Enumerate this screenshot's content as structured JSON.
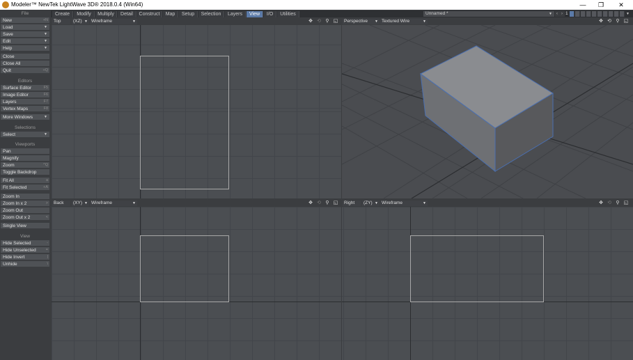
{
  "window": {
    "title": "Modeler™ NewTek LightWave 3D® 2018.0.4 (Win64)",
    "minimize": "—",
    "restore": "❐",
    "close": "✕"
  },
  "menu_tabs": [
    "Create",
    "Modify",
    "Multiply",
    "Detail",
    "Construct",
    "Map",
    "Setup",
    "Selection",
    "Layers",
    "View",
    "I/O",
    "Utilities"
  ],
  "active_tab": "View",
  "scene_name": "Unnamed *",
  "layer_number": "1",
  "sidebar": {
    "file_header": "File",
    "file_items": [
      {
        "label": "New",
        "shortcut": "+N"
      },
      {
        "label": "Load",
        "dropdown": true
      },
      {
        "label": "Save",
        "dropdown": true
      },
      {
        "label": "Edit",
        "dropdown": true
      },
      {
        "label": "Help",
        "dropdown": true
      }
    ],
    "misc_items": [
      {
        "label": "Close",
        "shortcut": ""
      },
      {
        "label": "Close All",
        "shortcut": ""
      },
      {
        "label": "Quit",
        "shortcut": "+Q"
      }
    ],
    "editors_header": "Editors",
    "editors_items": [
      {
        "label": "Surface Editor",
        "shortcut": "F5"
      },
      {
        "label": "Image Editor",
        "shortcut": "F6"
      },
      {
        "label": "Layers",
        "shortcut": "F7"
      },
      {
        "label": "Vertex Maps",
        "shortcut": "F8"
      }
    ],
    "more_windows": "More Windows",
    "selections_header": "Selections",
    "select": "Select",
    "viewports_header": "Viewports",
    "viewports_items": [
      {
        "label": "Pan",
        "shortcut": ""
      },
      {
        "label": "Magnify",
        "shortcut": ""
      },
      {
        "label": "Zoom",
        "shortcut": "^Q"
      },
      {
        "label": "Toggle Backdrop",
        "shortcut": ""
      },
      {
        "label": "Fit All",
        "shortcut": "a"
      },
      {
        "label": "Fit Selected",
        "shortcut": "+A"
      },
      {
        "label": "Zoom In",
        "shortcut": ""
      },
      {
        "label": "Zoom In x 2",
        "shortcut": ">"
      },
      {
        "label": "Zoom Out",
        "shortcut": ""
      },
      {
        "label": "Zoom Out x 2",
        "shortcut": "<"
      },
      {
        "label": "Single View",
        "shortcut": ""
      }
    ],
    "view_header": "View",
    "view_items": [
      {
        "label": "Hide Selected",
        "shortcut": "-"
      },
      {
        "label": "Hide Unselected",
        "shortcut": "="
      },
      {
        "label": "Hide Invert",
        "shortcut": "|"
      },
      {
        "label": "Unhide",
        "shortcut": "\\"
      }
    ]
  },
  "viewports": {
    "top": {
      "view": "Top",
      "axes": "(XZ)",
      "mode": "Wireframe"
    },
    "perspective": {
      "view": "Perspective",
      "mode": "Textured Wire"
    },
    "back": {
      "view": "Back",
      "axes": "(XY)",
      "mode": "Wireframe"
    },
    "right": {
      "view": "Right",
      "axes": "(ZY)",
      "mode": "Wireframe"
    }
  },
  "icons": {
    "move": "✥",
    "rotate": "⟲",
    "zoom": "🔍",
    "maximize": "◱"
  }
}
